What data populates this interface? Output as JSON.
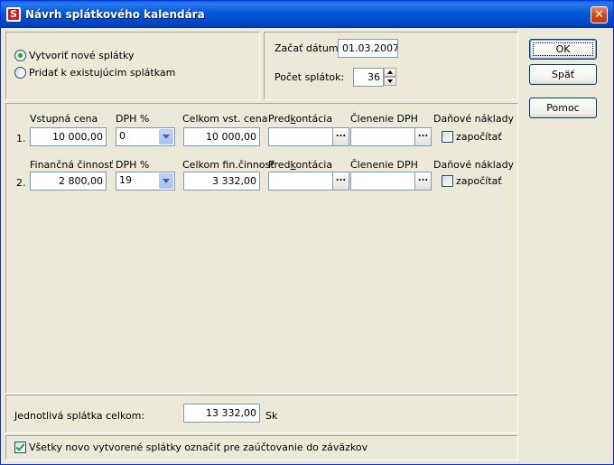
{
  "window": {
    "title": "Návrh splátkového kalendára"
  },
  "mode": {
    "options": [
      {
        "label": "Vytvoriť nové splátky",
        "checked": true
      },
      {
        "label": "Pridať k existujúcim splátkam",
        "checked": false
      }
    ]
  },
  "schedule": {
    "start_date_label": "Začať dátumom",
    "start_date_value": "01.03.2007",
    "count_label": "Počet splátok:",
    "count_value": "36"
  },
  "buttons": {
    "ok": "OK",
    "back": "Späť",
    "help": "Pomoc"
  },
  "rows": [
    {
      "number": "1.",
      "base_label": "Vstupná cena",
      "base_value": "10 000,00",
      "vat_label": "DPH %",
      "vat_value": "0",
      "total_label": "Celkom vst. cena",
      "total_value": "10 000,00",
      "predkontacia_label_a": "Pred",
      "predkontacia_label_k": "k",
      "predkontacia_label_b": "ontácia",
      "predkontacia_value": "",
      "clenenie_label": "Členenie DPH",
      "clenenie_value": "",
      "tax_label": "Daňové náklady",
      "tax_checkbox_label": "započítať",
      "tax_checked": false
    },
    {
      "number": "2.",
      "base_label": "Finančná činnosť",
      "base_value": "2 800,00",
      "vat_label": "DPH %",
      "vat_value": "19",
      "total_label": "Celkom fin.činnosť",
      "total_value": "3 332,00",
      "predkontacia_label_a": "Pred",
      "predkontacia_label_k": "k",
      "predkontacia_label_b": "ontácia",
      "predkontacia_value": "",
      "clenenie_label": "Členenie DPH",
      "clenenie_value": "",
      "tax_label": "Daňové náklady",
      "tax_checkbox_label": "započítať",
      "tax_checked": false
    }
  ],
  "summary": {
    "label": "Jednotlivá splátka celkom:",
    "value": "13 332,00",
    "currency": "Sk"
  },
  "footer": {
    "mark_label": "Všetky novo vytvorené splátky označiť pre zaúčtovanie do záväzkov",
    "mark_checked": true
  },
  "colors": {
    "title_bar": "#0458d8",
    "close_button": "#d3441c",
    "dialog_bg": "#ece9d8"
  },
  "icons": {
    "app": "app-icon",
    "close": "close-icon",
    "ellipsis": "ellipsis-icon",
    "dropdown": "chevron-down-icon"
  }
}
